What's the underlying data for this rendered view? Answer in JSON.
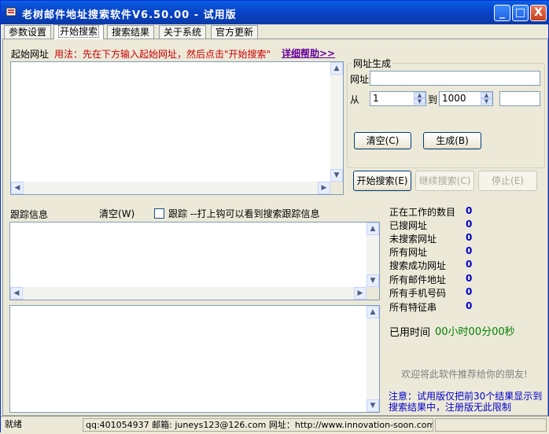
{
  "window": {
    "title": "老树邮件地址搜索软件V6.50.00 - 试用版",
    "minimize": "_",
    "maximize": "□",
    "close": "X"
  },
  "tabs": [
    "参数设置",
    "开始搜索",
    "搜索结果",
    "关于系统",
    "官方更新"
  ],
  "start_url": {
    "label": "起始网址",
    "usage": "用法：先在下方输入起始网址，然后点击\"开始搜索\"",
    "help_link": "详细帮助>>"
  },
  "url_gen": {
    "group_label": "网址生成",
    "url_label": "网址",
    "url_value": "",
    "from_label": "从",
    "from_value": "1",
    "to_label": "到",
    "to_value": "1000",
    "extra_value": "",
    "clear_button": "清空(C)",
    "generate_button": "生成(B)"
  },
  "search_buttons": {
    "start": "开始搜索(E)",
    "continue": "继续搜索(C)",
    "stop": "停止(E)"
  },
  "trace": {
    "label": "跟踪信息",
    "clear": "清空(W)",
    "checkbox_label": "跟踪 --打上钩可以看到搜索跟踪信息",
    "checked": false
  },
  "stats": [
    {
      "label": "正在工作的数目",
      "value": "0"
    },
    {
      "label": "已搜网址",
      "value": "0"
    },
    {
      "label": "未搜索网址",
      "value": "0"
    },
    {
      "label": "所有网址",
      "value": "0"
    },
    {
      "label": "搜索成功网址",
      "value": "0"
    },
    {
      "label": "所有邮件地址",
      "value": "0"
    },
    {
      "label": "所有手机号码",
      "value": "0"
    },
    {
      "label": "所有特征串",
      "value": "0"
    }
  ],
  "elapsed": {
    "label": "已用时间",
    "value": "00小时00分00秒"
  },
  "recommend": "欢迎将此软件推荐给你的朋友!",
  "notice": "注意：试用版仅把前30个结果显示到搜索结果中，注册版无此限制",
  "statusbar": {
    "ready": "就绪",
    "contact": "qq:401054937 邮箱: juneys123@126.com 网址：http://www.innovation-soon.com",
    "extra": ""
  },
  "colors": {
    "titlebar": "#0842c6",
    "usage_text": "#cc0000",
    "help_link": "#660099",
    "stat_value": "#0000cc",
    "elapsed_value": "#008000",
    "notice_text": "#0000cc"
  }
}
